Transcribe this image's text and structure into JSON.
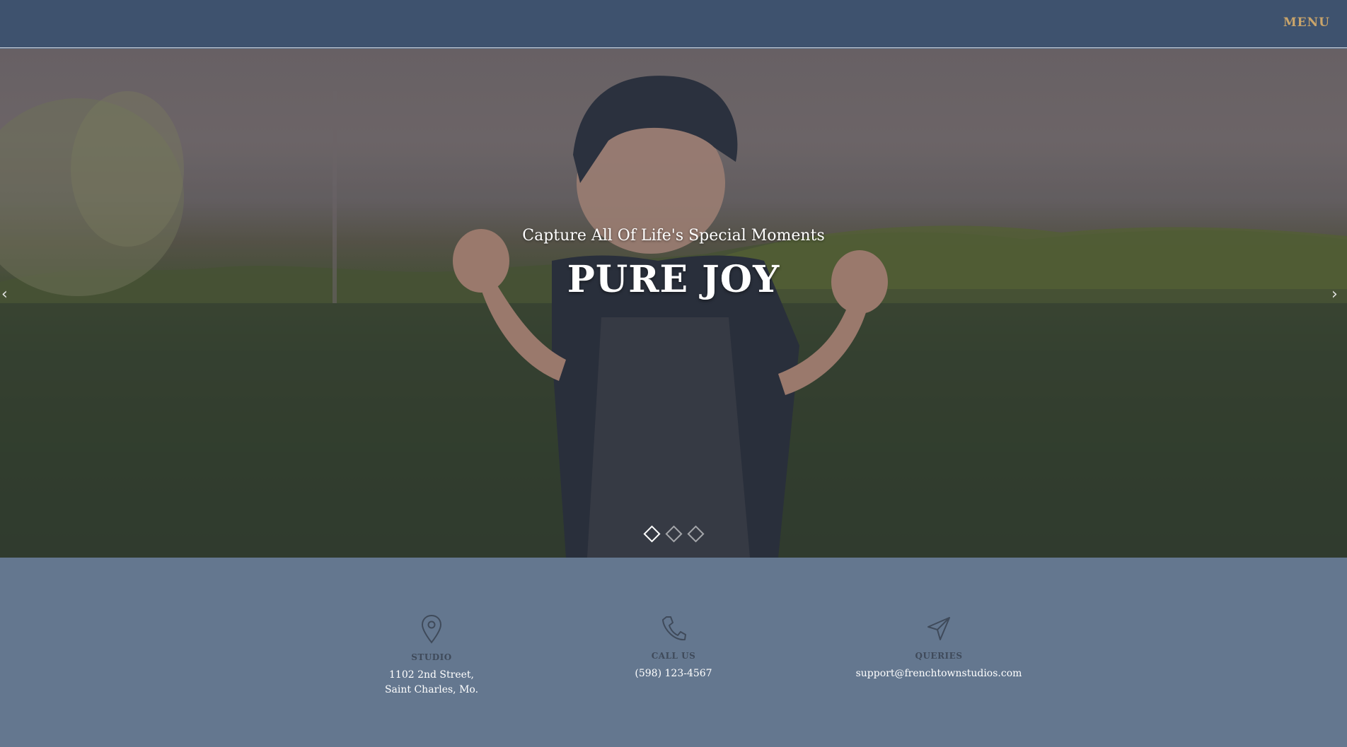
{
  "header": {
    "menu_label": "MENU",
    "bar_color": "#3e526e",
    "accent_color": "#c9a46a"
  },
  "hero": {
    "subtitle": "Capture All Of Life's Special Moments",
    "title": "PURE JOY",
    "prev_icon": "chevron-left-icon",
    "next_icon": "chevron-right-icon",
    "slide_count": 3,
    "active_slide": 1,
    "image_description_icon": "photo-background"
  },
  "info": {
    "background_color": "#64778f",
    "items": [
      {
        "icon": "map-pin-icon",
        "label": "STUDIO",
        "value": "1102 2nd Street, Saint Charles, Mo."
      },
      {
        "icon": "phone-icon",
        "label": "CALL US",
        "value": "(598) 123-4567"
      },
      {
        "icon": "paper-plane-icon",
        "label": "QUERIES",
        "value": "support@frenchtownstudios.com"
      }
    ]
  }
}
